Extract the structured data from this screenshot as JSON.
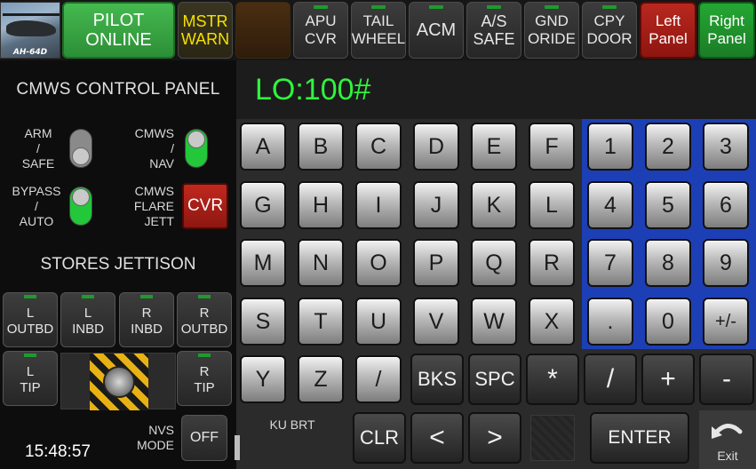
{
  "top_bar": {
    "logo_label": "AH-64D",
    "buttons": [
      {
        "id": "pilot",
        "lines": [
          "PILOT",
          "ONLINE"
        ]
      },
      {
        "id": "mstr",
        "lines": [
          "MSTR",
          "WARN"
        ]
      },
      {
        "id": "blank",
        "lines": [
          "",
          ""
        ]
      },
      {
        "id": "apu",
        "lines": [
          "APU",
          "CVR"
        ]
      },
      {
        "id": "tail",
        "lines": [
          "TAIL",
          "WHEEL"
        ]
      },
      {
        "id": "acm",
        "lines": [
          "ACM",
          ""
        ]
      },
      {
        "id": "as",
        "lines": [
          "A/S",
          "SAFE"
        ]
      },
      {
        "id": "gnd",
        "lines": [
          "GND",
          "ORIDE"
        ]
      },
      {
        "id": "cpy",
        "lines": [
          "CPY",
          "DOOR"
        ]
      },
      {
        "id": "left",
        "lines": [
          "Left",
          "Panel"
        ]
      },
      {
        "id": "right",
        "lines": [
          "Right",
          "Panel"
        ]
      }
    ]
  },
  "control_panel": {
    "title": "CMWS CONTROL PANEL",
    "arm": [
      "ARM",
      "/",
      "SAFE"
    ],
    "cmws_nav": [
      "CMWS",
      "/",
      "NAV"
    ],
    "bypass": [
      "BYPASS",
      "/",
      "AUTO"
    ],
    "flare": [
      "CMWS",
      "FLARE",
      "JETT"
    ],
    "cvr": "CVR"
  },
  "stores": {
    "title": "STORES JETTISON",
    "items": [
      {
        "lines": [
          "L",
          "OUTBD"
        ]
      },
      {
        "lines": [
          "L",
          "INBD"
        ]
      },
      {
        "lines": [
          "R",
          "INBD"
        ]
      },
      {
        "lines": [
          "R",
          "OUTBD"
        ]
      },
      {
        "lines": [
          "L",
          "TIP"
        ]
      },
      {
        "lines": [
          "R",
          "TIP"
        ]
      }
    ]
  },
  "nvs": {
    "label": [
      "NVS",
      "MODE"
    ],
    "value": "OFF"
  },
  "ku_brt": "KU BRT",
  "clock": "15:48:57",
  "display": {
    "text": "LO:100#"
  },
  "keypad": {
    "letters": [
      "A",
      "B",
      "C",
      "D",
      "E",
      "F",
      "G",
      "H",
      "I",
      "J",
      "K",
      "L",
      "M",
      "N",
      "O",
      "P",
      "Q",
      "R",
      "S",
      "T",
      "U",
      "V",
      "W",
      "X",
      "Y",
      "Z",
      "/"
    ],
    "numbers": [
      "1",
      "2",
      "3",
      "4",
      "5",
      "6",
      "7",
      "8",
      "9",
      ".",
      "0",
      "+/-"
    ],
    "bottom": [
      "BKS",
      "SPC",
      "*",
      "/",
      "+",
      "-"
    ],
    "last": [
      "CLR",
      "<",
      ">"
    ],
    "enter": "ENTER",
    "exit": "Exit"
  }
}
